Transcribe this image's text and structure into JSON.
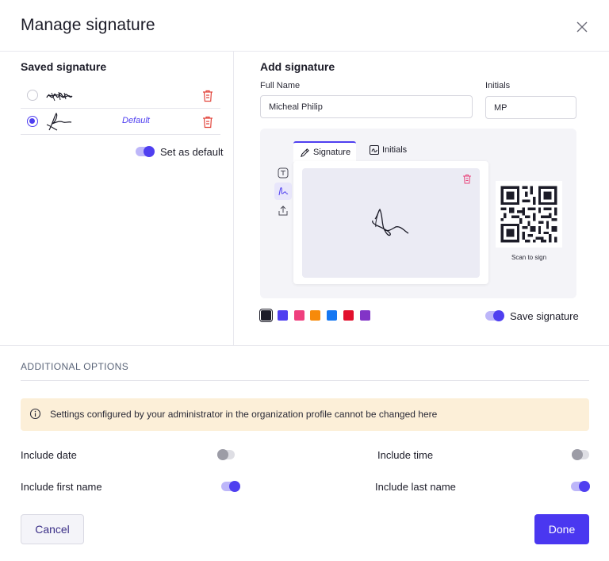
{
  "dialog": {
    "title": "Manage signature"
  },
  "saved": {
    "title": "Saved signature",
    "default_tag": "Default",
    "set_default_label": "Set as default",
    "set_default_on": true
  },
  "add": {
    "title": "Add signature",
    "full_name_label": "Full Name",
    "full_name_value": "Micheal Philip",
    "initials_label": "Initials",
    "initials_value": "MP",
    "tabs": [
      {
        "label": "Signature",
        "active": true
      },
      {
        "label": "Initials",
        "active": false
      }
    ],
    "scan_label": "Scan to sign",
    "colors": [
      "#1c1c28",
      "#4f3ff0",
      "#ef3f7e",
      "#f78a0a",
      "#1577f2",
      "#e2102d",
      "#8234c7"
    ],
    "selected_color": "#1c1c28",
    "save_signature_label": "Save signature",
    "save_signature_on": true
  },
  "options": {
    "title": "ADDITIONAL OPTIONS",
    "notice": "Settings configured by your administrator in the organization profile cannot be changed here",
    "include_date": {
      "label": "Include date",
      "on": false
    },
    "include_time": {
      "label": "Include time",
      "on": false
    },
    "include_first_name": {
      "label": "Include first name",
      "on": true
    },
    "include_last_name": {
      "label": "Include last name",
      "on": true
    }
  },
  "footer": {
    "cancel_label": "Cancel",
    "done_label": "Done"
  },
  "theme": {
    "accent": "#4f3ff0",
    "danger": "#e2453c",
    "notice_bg": "#fcefd8"
  }
}
